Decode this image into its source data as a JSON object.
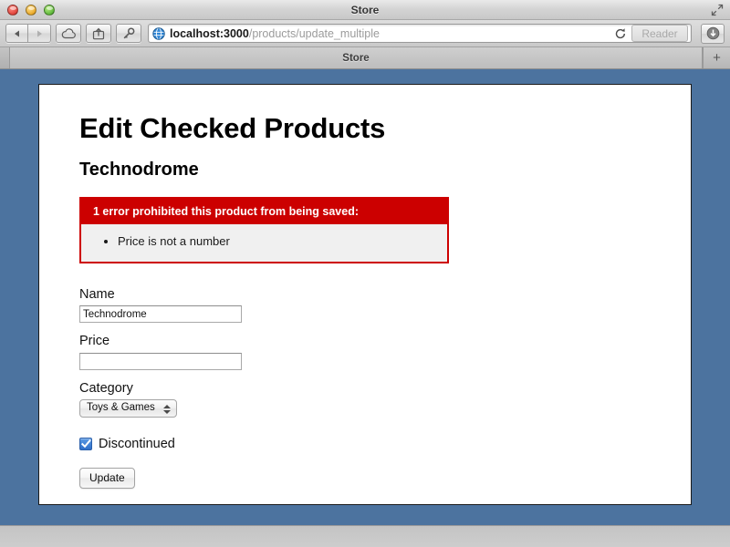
{
  "window": {
    "title": "Store",
    "traffic_lights": [
      "close",
      "minimize",
      "zoom"
    ],
    "fullscreen_icon": "fullscreen-arrows-icon"
  },
  "toolbar": {
    "back_icon": "back-arrow-icon",
    "forward_icon": "forward-arrow-icon",
    "icloud_icon": "icloud-tabs-icon",
    "share_icon": "share-icon",
    "key_icon": "password-key-icon",
    "favicon": "globe-favicon",
    "url_host": "localhost:3000",
    "url_path": "/products/update_multiple",
    "url_full": "localhost:3000/products/update_multiple",
    "reload_icon": "reload-icon",
    "reader_label": "Reader",
    "downloads_icon": "downloads-arrow-icon"
  },
  "tab_bar": {
    "tab_label": "Store",
    "new_tab_label": "+"
  },
  "page": {
    "title": "Edit Checked Products",
    "product_heading": "Technodrome",
    "error": {
      "heading": "1 error prohibited this product from being saved:",
      "items": [
        "Price is not a number"
      ],
      "header_color": "#cc0000",
      "body_color": "#f0f0f0",
      "border_color": "#cd0000"
    },
    "form": {
      "name_label": "Name",
      "name_value": "Technodrome",
      "name_placeholder": "",
      "price_label": "Price",
      "price_value": "",
      "price_placeholder": "",
      "category_label": "Category",
      "category_value": "Toys & Games",
      "discontinued_label": "Discontinued",
      "discontinued_checked": true,
      "checkbox_color": "#3b7dd8",
      "submit_label": "Update"
    }
  },
  "colors": {
    "page_background": "#4c739f",
    "card_background": "#ffffff",
    "desktop": "#c6c6c6"
  }
}
